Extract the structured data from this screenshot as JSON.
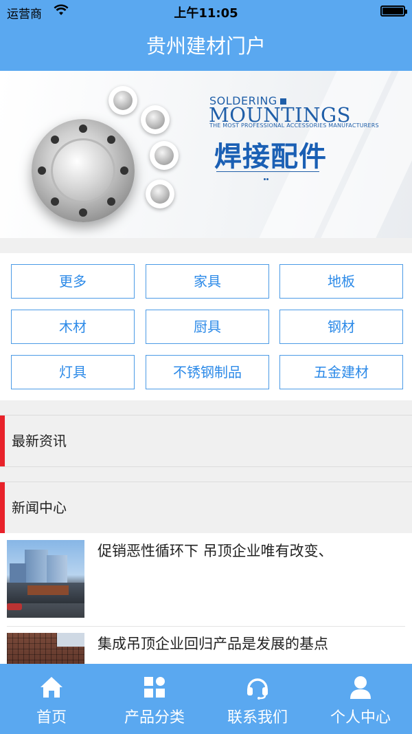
{
  "status_bar": {
    "carrier": "运营商",
    "time": "上午11:05"
  },
  "header": {
    "title": "贵州建材门户"
  },
  "banner": {
    "line1": "SOLDERING",
    "line2": "MOUNTINGS",
    "line3": "THE MOST PROFESSIONAL ACCESSORIES MANUFACTURERS",
    "line4": "焊接配件"
  },
  "categories": [
    {
      "label": "更多"
    },
    {
      "label": "家具"
    },
    {
      "label": "地板"
    },
    {
      "label": "木材"
    },
    {
      "label": "厨具"
    },
    {
      "label": "钢材"
    },
    {
      "label": "灯具"
    },
    {
      "label": "不锈钢制品"
    },
    {
      "label": "五金建材"
    }
  ],
  "sections": {
    "latest": "最新资讯",
    "news_center": "新闻中心"
  },
  "news": [
    {
      "headline": "促销恶性循环下 吊顶企业唯有改变、"
    },
    {
      "headline": "集成吊顶企业回归产品是发展的基点"
    }
  ],
  "tabbar": [
    {
      "label": "首页",
      "icon": "home-icon"
    },
    {
      "label": "产品分类",
      "icon": "grid-icon"
    },
    {
      "label": "联系我们",
      "icon": "headset-icon"
    },
    {
      "label": "个人中心",
      "icon": "user-icon"
    }
  ],
  "colors": {
    "primary": "#5aa8f0",
    "category_border": "#4a9ae6",
    "category_text": "#2c8ae8",
    "section_accent": "#e8222a"
  }
}
